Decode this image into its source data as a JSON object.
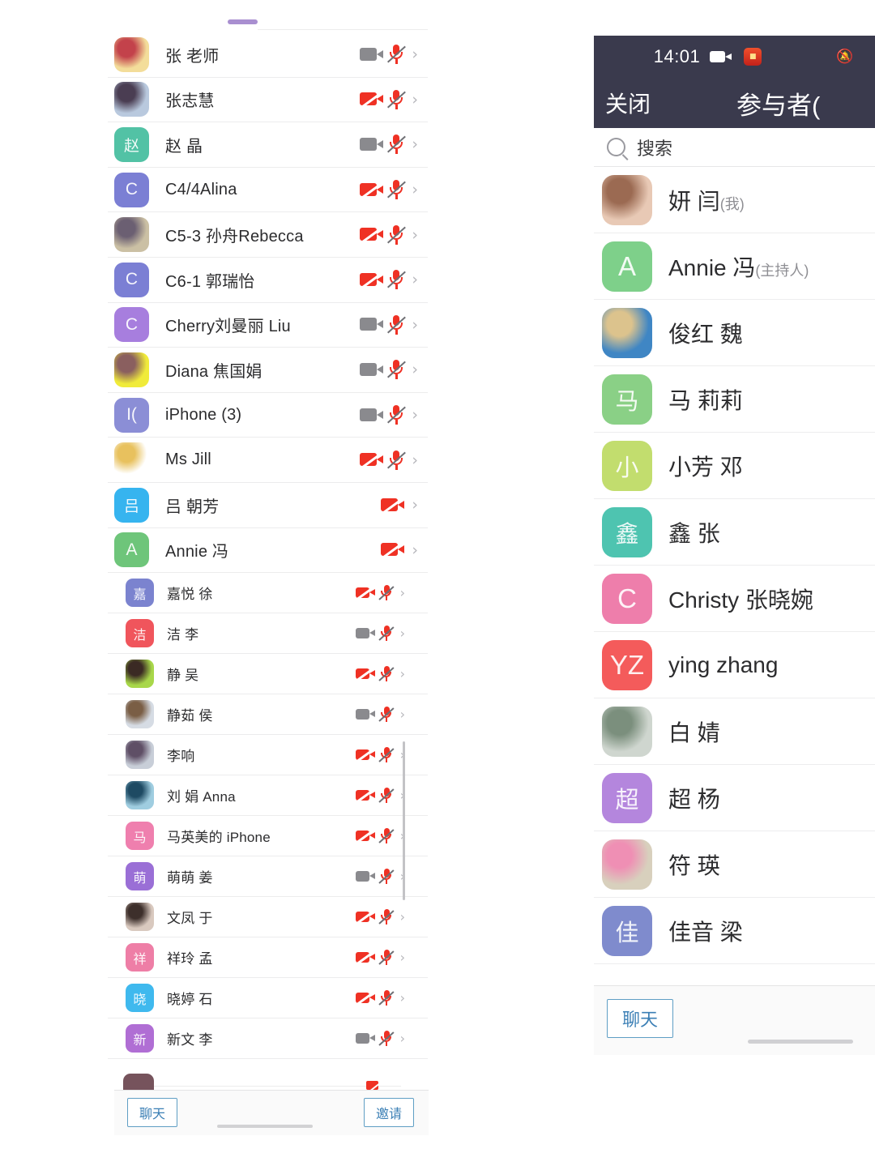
{
  "left_panel": {
    "scroll_top_partial": true,
    "participants": [
      {
        "name": "张 老师",
        "avatar": {
          "type": "photo",
          "colors": [
            "#f3dd9a",
            "#c3424b"
          ]
        },
        "video": "on",
        "mic": "muted",
        "chevron": "›",
        "indent": false
      },
      {
        "name": "张志慧",
        "avatar": {
          "type": "photo",
          "colors": [
            "#b9c9de",
            "#4a3d52"
          ]
        },
        "video": "off",
        "mic": "muted",
        "chevron": "›",
        "indent": false
      },
      {
        "name": "赵 晶",
        "avatar": {
          "type": "initial",
          "text": "赵",
          "color": "#52c2a5"
        },
        "video": "on",
        "mic": "muted",
        "chevron": "›",
        "indent": false
      },
      {
        "name": "C4/4Alina",
        "avatar": {
          "type": "initial",
          "text": "C",
          "color": "#7b7fd4",
          "latin": true
        },
        "video": "off",
        "mic": "muted",
        "chevron": "›",
        "indent": false
      },
      {
        "name": "C5-3 孙舟Rebecca",
        "avatar": {
          "type": "photo",
          "colors": [
            "#cbc0a4",
            "#6b5f72"
          ]
        },
        "video": "off",
        "mic": "muted",
        "chevron": "›",
        "indent": false
      },
      {
        "name": "C6-1 郭瑞怡",
        "avatar": {
          "type": "initial",
          "text": "C",
          "color": "#7b7fd4",
          "latin": true
        },
        "video": "off",
        "mic": "muted",
        "chevron": "›",
        "indent": false
      },
      {
        "name": "Cherry刘曼丽 Liu",
        "avatar": {
          "type": "initial",
          "text": "C",
          "color": "#a77ede",
          "latin": true
        },
        "video": "on",
        "mic": "muted",
        "chevron": "›",
        "indent": false
      },
      {
        "name": "Diana 焦国娟",
        "avatar": {
          "type": "photo",
          "colors": [
            "#f0eb3a",
            "#8a5f5f"
          ]
        },
        "video": "on",
        "mic": "muted",
        "chevron": "›",
        "indent": false
      },
      {
        "name": "iPhone (3)",
        "avatar": {
          "type": "initial",
          "text": "I(",
          "color": "#8b8ed6",
          "latin": true
        },
        "video": "on",
        "mic": "muted",
        "chevron": "›",
        "indent": false
      },
      {
        "name": "Ms Jill",
        "avatar": {
          "type": "photo",
          "colors": [
            "#ffffff",
            "#e8c15e"
          ]
        },
        "video": "off",
        "mic": "muted",
        "chevron": "›",
        "indent": false
      },
      {
        "name": "吕 朝芳",
        "avatar": {
          "type": "initial",
          "text": "吕",
          "color": "#36b4ef"
        },
        "video": "off",
        "mic": "none",
        "chevron": "›",
        "indent": false
      },
      {
        "name": "Annie 冯",
        "avatar": {
          "type": "initial",
          "text": "A",
          "color": "#6ec57a",
          "latin": true
        },
        "video": "off",
        "mic": "none",
        "chevron": "›",
        "indent": false
      },
      {
        "name": "嘉悦 徐",
        "avatar": {
          "type": "initial",
          "text": "嘉",
          "color": "#7b83cf"
        },
        "video": "off",
        "mic": "muted",
        "chevron": "›",
        "indent": true
      },
      {
        "name": "洁 李",
        "avatar": {
          "type": "initial",
          "text": "洁",
          "color": "#f0555c"
        },
        "video": "on",
        "mic": "muted",
        "chevron": "›",
        "indent": true
      },
      {
        "name": "静 吴",
        "avatar": {
          "type": "photo",
          "colors": [
            "#a8d74a",
            "#3b2a24"
          ]
        },
        "video": "off",
        "mic": "muted",
        "chevron": "›",
        "indent": true
      },
      {
        "name": "静茹 侯",
        "avatar": {
          "type": "photo",
          "colors": [
            "#d6dce4",
            "#7a5e45"
          ]
        },
        "video": "on",
        "mic": "muted",
        "chevron": "›",
        "indent": true
      },
      {
        "name": "李响",
        "avatar": {
          "type": "photo",
          "colors": [
            "#c8ced8",
            "#5f4f66"
          ]
        },
        "video": "off",
        "mic": "muted",
        "chevron": "›",
        "indent": true
      },
      {
        "name": "刘 娟 Anna",
        "avatar": {
          "type": "photo",
          "colors": [
            "#9fcde0",
            "#1e4a63"
          ]
        },
        "video": "off",
        "mic": "muted",
        "chevron": "›",
        "indent": true
      },
      {
        "name": "马英美的 iPhone",
        "avatar": {
          "type": "initial",
          "text": "马",
          "color": "#ef7fae"
        },
        "video": "off",
        "mic": "muted",
        "chevron": "›",
        "indent": true
      },
      {
        "name": "萌萌 姜",
        "avatar": {
          "type": "initial",
          "text": "萌",
          "color": "#9a6fd6"
        },
        "video": "on",
        "mic": "muted",
        "chevron": "›",
        "indent": true
      },
      {
        "name": "文凤 于",
        "avatar": {
          "type": "photo",
          "colors": [
            "#d9c9bf",
            "#3d2f2b"
          ]
        },
        "video": "off",
        "mic": "muted",
        "chevron": "›",
        "indent": true
      },
      {
        "name": "祥玲 孟",
        "avatar": {
          "type": "initial",
          "text": "祥",
          "color": "#ee7ea6"
        },
        "video": "off",
        "mic": "muted",
        "chevron": "›",
        "indent": true
      },
      {
        "name": "晓婷 石",
        "avatar": {
          "type": "initial",
          "text": "晓",
          "color": "#3fb9ee"
        },
        "video": "off",
        "mic": "muted",
        "chevron": "›",
        "indent": true
      },
      {
        "name": "新文 李",
        "avatar": {
          "type": "initial",
          "text": "新",
          "color": "#b06ed4"
        },
        "video": "on",
        "mic": "muted",
        "chevron": "›",
        "indent": true
      }
    ],
    "bottom_bar": {
      "chat_label": "聊天",
      "invite_label": "邀请"
    }
  },
  "right_panel": {
    "status_bar": {
      "time": "14:01",
      "camera_icon": "video-camera-icon",
      "app_badge": "app-badge-icon",
      "mute_icon": "bell-muted-icon"
    },
    "nav_bar": {
      "close_label": "关闭",
      "title": "参与者("
    },
    "search": {
      "placeholder": "搜索",
      "icon": "search-icon"
    },
    "participants": [
      {
        "name": "妍 闫",
        "tag": "(我)",
        "avatar": {
          "type": "photo",
          "colors": [
            "#e8c9b5",
            "#9b6a52"
          ]
        }
      },
      {
        "name": "Annie 冯",
        "tag": "(主持人)",
        "avatar": {
          "type": "initial",
          "text": "A",
          "color": "#7ed08a",
          "latin": true
        }
      },
      {
        "name": "俊红 魏",
        "tag": "",
        "avatar": {
          "type": "photo",
          "colors": [
            "#3f86c4",
            "#dcc38d"
          ]
        }
      },
      {
        "name": "马 莉莉",
        "tag": "",
        "avatar": {
          "type": "initial",
          "text": "马",
          "color": "#8ad086"
        }
      },
      {
        "name": "小芳 邓",
        "tag": "",
        "avatar": {
          "type": "initial",
          "text": "小",
          "color": "#c2dd6e"
        }
      },
      {
        "name": "鑫 张",
        "tag": "",
        "avatar": {
          "type": "initial",
          "text": "鑫",
          "color": "#4ec4b0"
        }
      },
      {
        "name": "Christy 张晓婉",
        "tag": "",
        "avatar": {
          "type": "initial",
          "text": "C",
          "color": "#ee7eab",
          "latin": true
        }
      },
      {
        "name": "ying zhang",
        "tag": "",
        "avatar": {
          "type": "initial",
          "text": "YZ",
          "color": "#f45b5b",
          "latin": true
        }
      },
      {
        "name": "白 婧",
        "tag": "",
        "avatar": {
          "type": "photo",
          "colors": [
            "#cfd6cf",
            "#7b8f7d"
          ]
        }
      },
      {
        "name": "超 杨",
        "tag": "",
        "avatar": {
          "type": "initial",
          "text": "超",
          "color": "#b486dd"
        }
      },
      {
        "name": "符 瑛",
        "tag": "",
        "avatar": {
          "type": "photo",
          "colors": [
            "#d8d0bd",
            "#ef8fb4"
          ]
        }
      },
      {
        "name": "佳音 梁",
        "tag": "",
        "avatar": {
          "type": "initial",
          "text": "佳",
          "color": "#7f8bcd"
        }
      }
    ],
    "bottom_bar": {
      "chat_label": "聊天"
    }
  },
  "colors": {
    "accent_blue": "#3b7fb5",
    "mute_red": "#ef3124",
    "camera_gray": "#8a8a8e",
    "navbar_dark": "#3a3a4d"
  }
}
